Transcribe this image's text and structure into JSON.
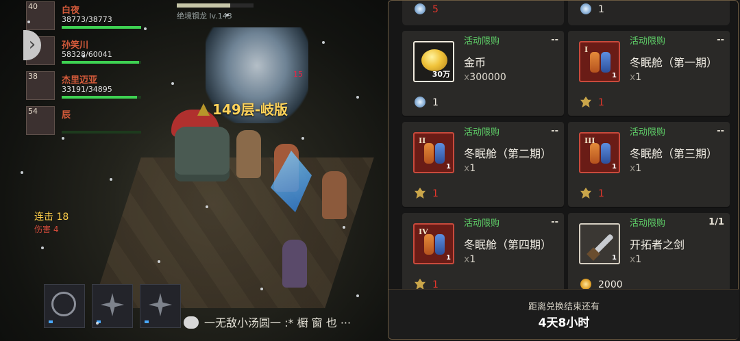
{
  "game": {
    "party": [
      {
        "level": "40",
        "name": "白夜",
        "hp": "38773/38773",
        "hp_fraction": 1.0
      },
      {
        "level": "40",
        "name": "孙笑川",
        "hp": "58328/60041",
        "hp_fraction": 0.97
      },
      {
        "level": "38",
        "name": "杰里迈亚",
        "hp": "33191/34895",
        "hp_fraction": 0.95
      },
      {
        "level": "54",
        "name": "辰",
        "hp": "",
        "hp_fraction": 0.0
      }
    ],
    "boss_name": "绝境钢龙 lv.143",
    "floor_label": "149层-岐版",
    "damage_text": "15",
    "combo_label": "连击 18",
    "combo_sub": "伤害 4",
    "chat_text": "一无敌小汤圆一 :* 橱 窗 也 ···",
    "skills": [
      {
        "icon": "crosshair-icon"
      },
      {
        "icon": "burst-icon"
      },
      {
        "icon": "card-icon"
      }
    ]
  },
  "shop": {
    "top_left_price": "5",
    "top_right_price": "1",
    "tag": "活动限购",
    "items": [
      {
        "name": "金币",
        "qty": "300000",
        "limit": "--",
        "price": "1",
        "currency": "blue",
        "thumb": "gold",
        "thumb_label": "30万",
        "price_red": false
      },
      {
        "name": "冬眠舱（第一期）",
        "qty": "1",
        "limit": "--",
        "price": "1",
        "currency": "totem",
        "thumb": "pod",
        "roman": "I",
        "thumb_label": "1",
        "price_red": true
      },
      {
        "name": "冬眠舱（第二期）",
        "qty": "1",
        "limit": "--",
        "price": "1",
        "currency": "totem",
        "thumb": "pod",
        "roman": "II",
        "thumb_label": "1",
        "price_red": true
      },
      {
        "name": "冬眠舱（第三期）",
        "qty": "1",
        "limit": "--",
        "price": "1",
        "currency": "totem",
        "thumb": "pod",
        "roman": "III",
        "thumb_label": "1",
        "price_red": true
      },
      {
        "name": "冬眠舱（第四期）",
        "qty": "1",
        "limit": "--",
        "price": "1",
        "currency": "totem",
        "thumb": "pod",
        "roman": "IV",
        "thumb_label": "1",
        "price_red": true
      },
      {
        "name": "开拓者之剑",
        "qty": "1",
        "limit": "1/1",
        "price": "2000",
        "currency": "gold",
        "thumb": "weapon",
        "thumb_label": "1",
        "price_red": false
      }
    ],
    "footer_label": "距离兑换结束还有",
    "footer_time": "4天8小时",
    "qty_prefix": "x"
  }
}
